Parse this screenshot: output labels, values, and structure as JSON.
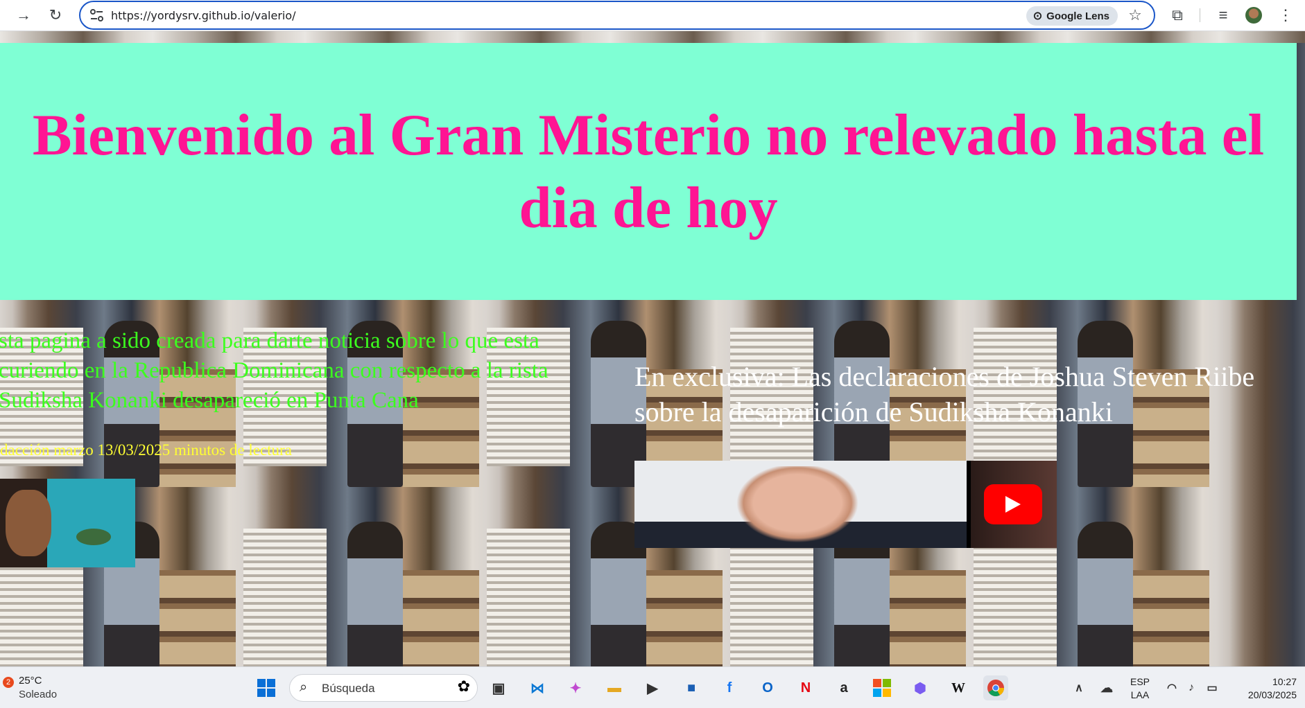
{
  "browser": {
    "url": "https://yordysrv.github.io/valerio/",
    "lens_label": "Google Lens"
  },
  "page": {
    "title": "Bienvenido al Gran Misterio no relevado hasta el dia de hoy",
    "lead": "sta pagina a sido creada para darte noticia sobre lo que esta curiendo en la Republica Dominicana con respecto a la rista Sudiksha Konanki desapareció en Punta Cana",
    "byline": "dacción marzo 13/03/2025 minutos de lectura",
    "exclusive": "En exclusiva: Las declaraciones de Joshua Steven Riibe sobre la desaparición de Sudiksha Konanki",
    "colors": {
      "header_bg": "#7fffd4",
      "title": "#ff1493",
      "lead": "#3cff1e",
      "byline": "#ffff33",
      "exclusive": "#ffffff"
    }
  },
  "taskbar": {
    "weather_badge": "2",
    "weather_temp": "25°C",
    "weather_cond": "Soleado",
    "search_placeholder": "Búsqueda",
    "lang_top": "ESP",
    "lang_bottom": "LAA",
    "time": "10:27",
    "date": "20/03/2025",
    "apps": [
      "windows-start-icon",
      "file-manager-icon",
      "vscode-icon",
      "copilot-icon",
      "folder-icon",
      "media-player-icon",
      "store-icon",
      "facebook-icon",
      "outlook-icon",
      "netflix-icon",
      "amazon-icon",
      "microsoft-icon",
      "copilot-app-icon",
      "wikipedia-icon",
      "chrome-icon"
    ]
  }
}
